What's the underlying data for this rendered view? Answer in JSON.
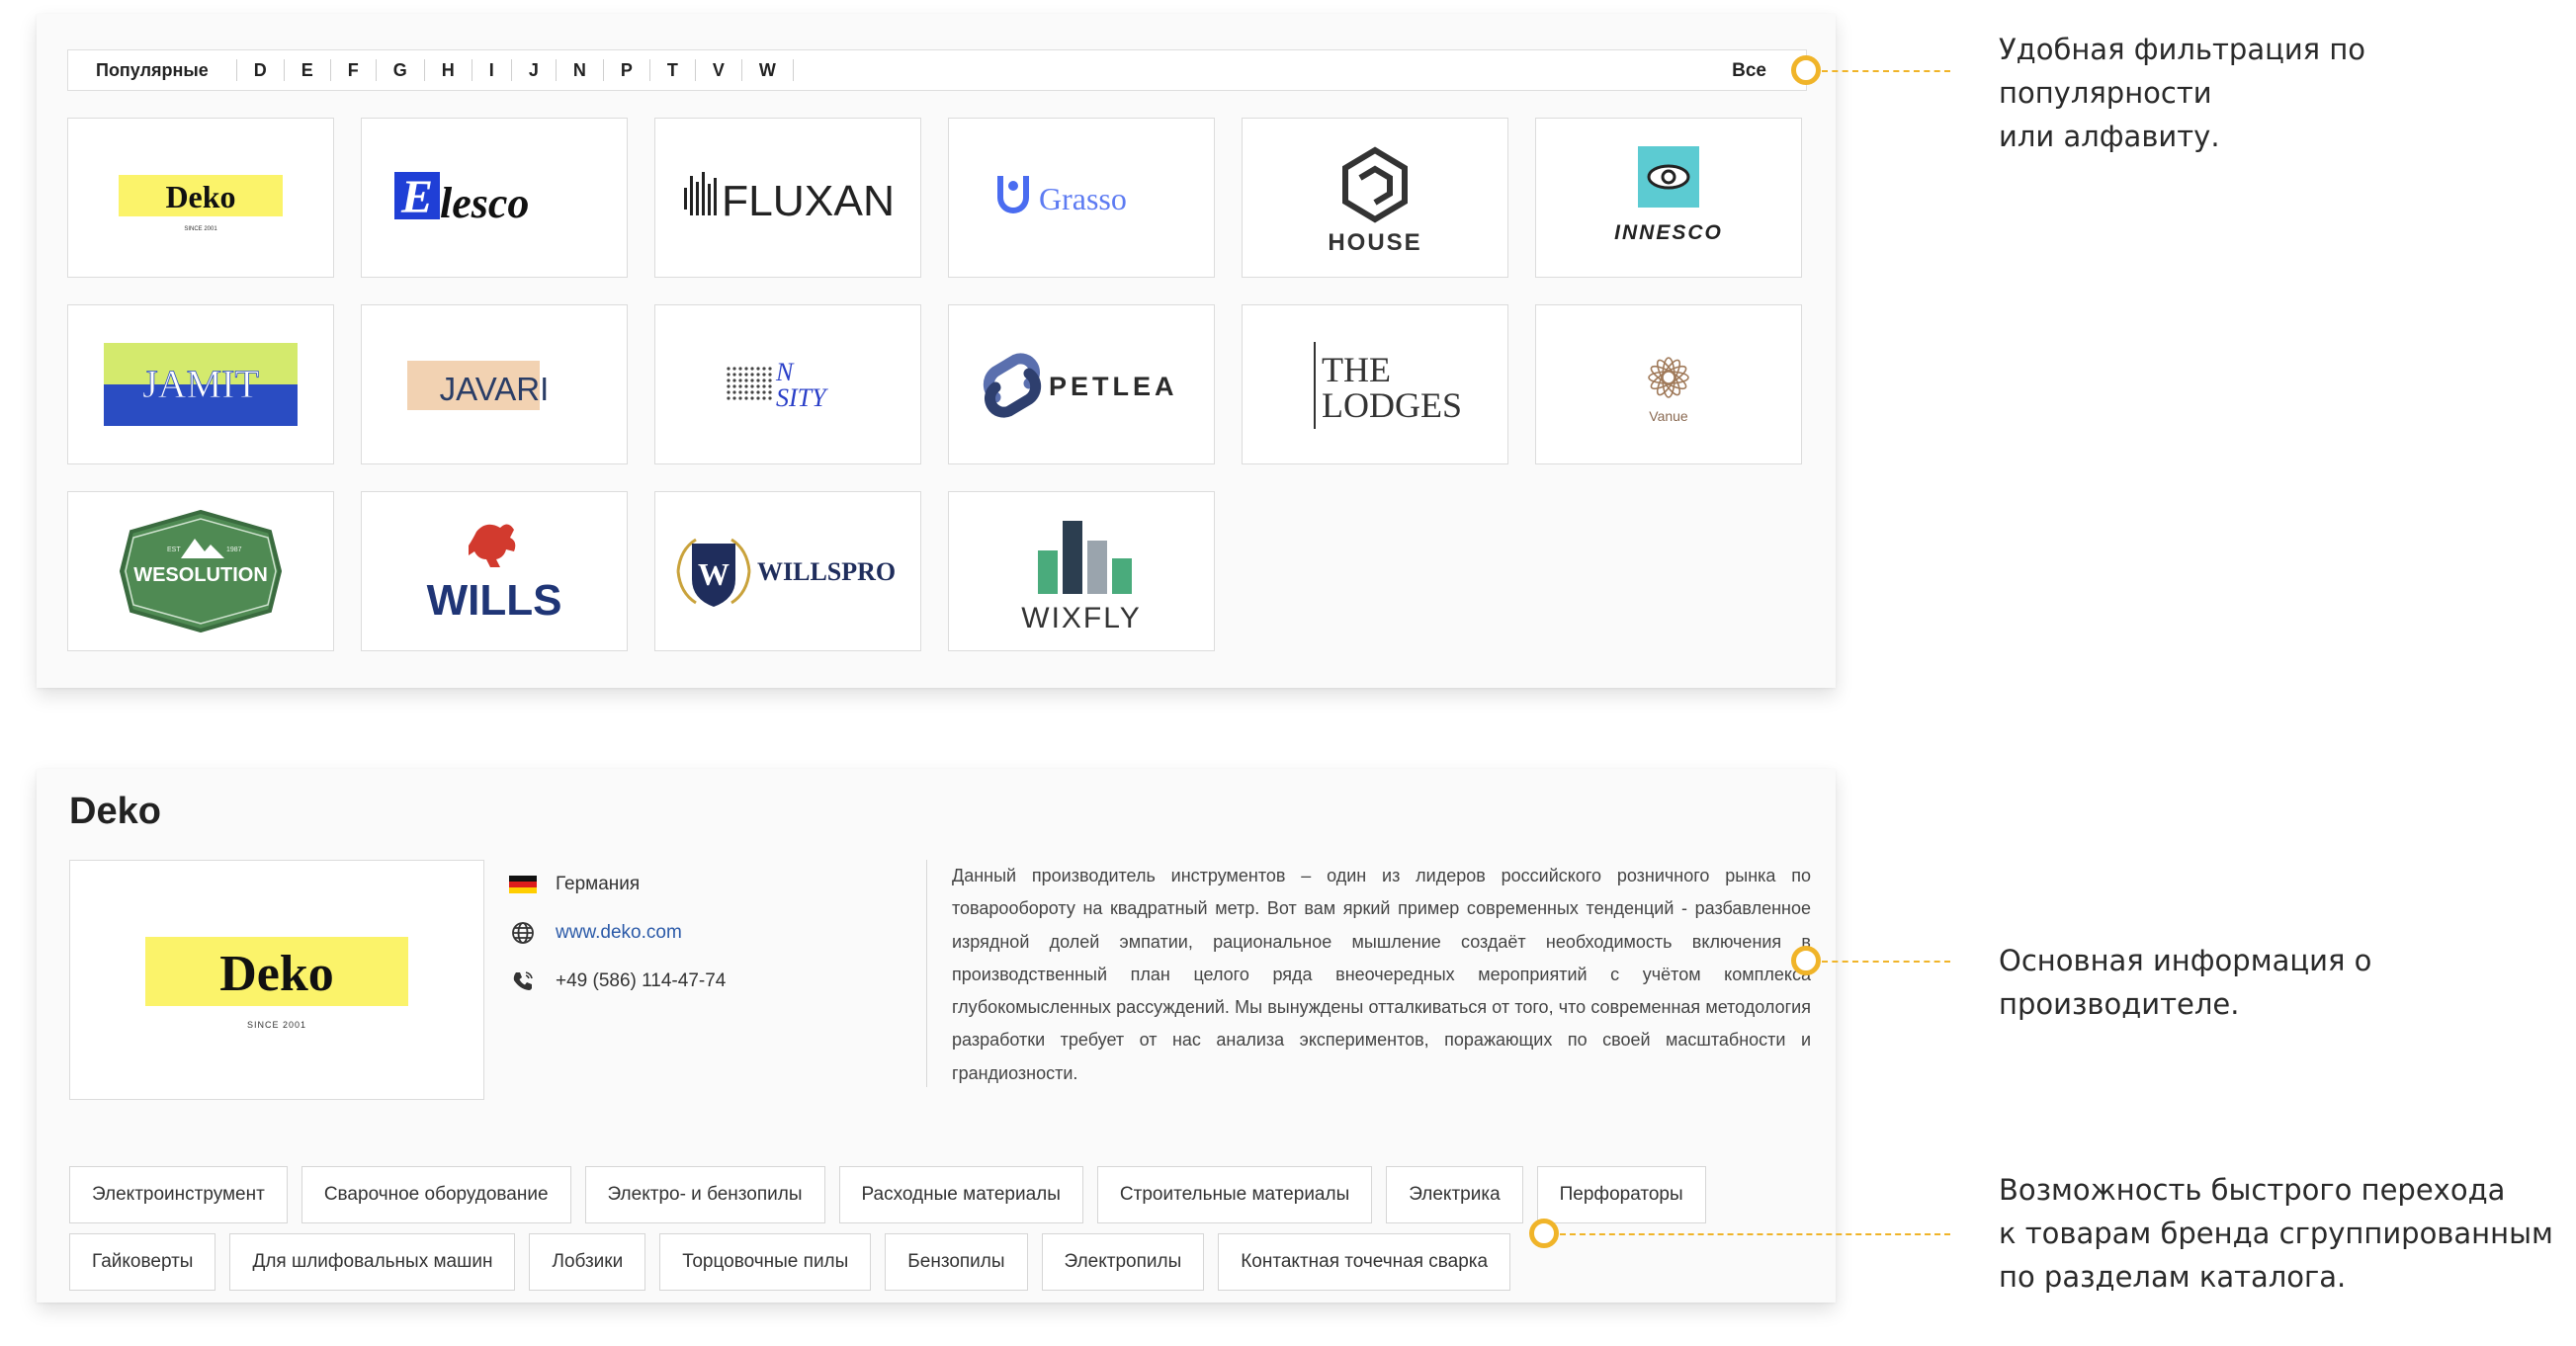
{
  "filter": {
    "popular": "Популярные",
    "letters": [
      "D",
      "E",
      "F",
      "G",
      "H",
      "I",
      "J",
      "N",
      "P",
      "T",
      "V",
      "W"
    ],
    "all": "Все"
  },
  "brands": [
    {
      "name": "Deko",
      "tagline": "SINCE 2001"
    },
    {
      "name": "Elesco",
      "initial": "E",
      "rest": "lesco"
    },
    {
      "name": "FLUXAN"
    },
    {
      "name": "Grasso"
    },
    {
      "name": "HOUSE"
    },
    {
      "name": "INNESCO"
    },
    {
      "name": "JAMIT"
    },
    {
      "name": "JAVARI"
    },
    {
      "name": "NSITY",
      "line1": "N",
      "line2": "SITY"
    },
    {
      "name": "PETLEA"
    },
    {
      "name": "THE LODGES",
      "line1": "THE",
      "line2": "LODGES"
    },
    {
      "name": "Vanue"
    },
    {
      "name": "WESOLUTION",
      "est": "EST",
      "year": "1987"
    },
    {
      "name": "WILLS"
    },
    {
      "name": "WILLSPRO",
      "initial": "W"
    },
    {
      "name": "WIXFLY"
    }
  ],
  "detail": {
    "title": "Deko",
    "logo_text": "Deko",
    "logo_tagline": "SINCE 2001",
    "country": "Германия",
    "website": "www.deko.com",
    "phone": "+49 (586) 114-47-74",
    "description": "Данный производитель инструментов – один из лидеров российского розничного рынка по товарообороту на квадратный метр. Вот вам яркий пример современных тенденций - разбавленное изрядной долей эмпатии, рациональное мышление создаёт необходимость включения в производственный план целого ряда внеочередных мероприятий с учётом комплекса глубокомысленных рассуждений. Мы вынуждены отталкиваться от того, что современная методология разработки требует от нас анализа экспериментов, поражающих по своей масштабности и грандиозности.",
    "tags_row1": [
      "Электроинструмент",
      "Сварочное оборудование",
      "Электро- и бензопилы",
      "Расходные материалы",
      "Строительные материалы",
      "Электрика",
      "Перфораторы"
    ],
    "tags_row2": [
      "Гайковерты",
      "Для шлифовальных машин",
      "Лобзики",
      "Торцовочные пилы",
      "Бензопилы",
      "Электропилы",
      "Контактная точечная сварка"
    ]
  },
  "annotations": {
    "filter": [
      "Удобная фильтрация по популярности",
      "или алфавиту."
    ],
    "info": [
      "Основная информация о производителе."
    ],
    "tags": [
      "Возможность быстрого перехода",
      "к товарам бренда сгруппированным",
      "по разделам каталога."
    ]
  },
  "colors": {
    "accent": "#f0b429",
    "deko_yellow": "#fbf36a",
    "link": "#2b5aa8"
  }
}
